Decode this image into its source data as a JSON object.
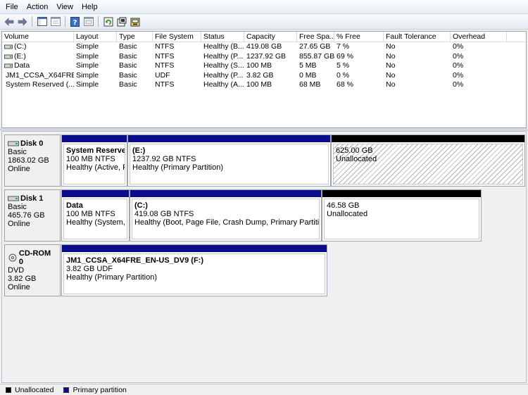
{
  "menu": [
    "File",
    "Action",
    "View",
    "Help"
  ],
  "toolbar": {
    "buttons": [
      "back-arrow-icon",
      "forward-arrow-icon",
      "console-tree-icon",
      "properties-icon",
      "help-icon",
      "export-icon",
      "refresh-icon",
      "settings-icon",
      "disk-icon"
    ]
  },
  "volume_list": {
    "columns": [
      "Volume",
      "Layout",
      "Type",
      "File System",
      "Status",
      "Capacity",
      "Free Spa...",
      "% Free",
      "Fault Tolerance",
      "Overhead"
    ],
    "rows": [
      [
        "(C:)",
        "Simple",
        "Basic",
        "NTFS",
        "Healthy (B...",
        "419.08 GB",
        "27.65 GB",
        "7 %",
        "No",
        "0%"
      ],
      [
        "(E:)",
        "Simple",
        "Basic",
        "NTFS",
        "Healthy (P...",
        "1237.92 GB",
        "855.87 GB",
        "69 %",
        "No",
        "0%"
      ],
      [
        "Data",
        "Simple",
        "Basic",
        "NTFS",
        "Healthy (S...",
        "100 MB",
        "5 MB",
        "5 %",
        "No",
        "0%"
      ],
      [
        "JM1_CCSA_X64FRE...",
        "Simple",
        "Basic",
        "UDF",
        "Healthy (P...",
        "3.82 GB",
        "0 MB",
        "0 %",
        "No",
        "0%"
      ],
      [
        "System Reserved (...",
        "Simple",
        "Basic",
        "NTFS",
        "Healthy (A...",
        "100 MB",
        "68 MB",
        "68 %",
        "No",
        "0%"
      ]
    ]
  },
  "disks": [
    {
      "name": "Disk 0",
      "type": "Basic",
      "size": "1863.02 GB",
      "status": "Online",
      "partitions": [
        {
          "kind": "primary",
          "name": "System Reserved",
          "size": "100 MB NTFS",
          "status": "Healthy (Active, Pri"
        },
        {
          "kind": "primary",
          "name": "(E:)",
          "size": "1237.92 GB NTFS",
          "status": "Healthy (Primary Partition)"
        },
        {
          "kind": "unalloc",
          "name": "",
          "size": "625.00 GB",
          "status": "Unallocated"
        }
      ]
    },
    {
      "name": "Disk 1",
      "type": "Basic",
      "size": "465.76 GB",
      "status": "Online",
      "partitions": [
        {
          "kind": "primary",
          "name": "Data",
          "size": "100 MB NTFS",
          "status": "Healthy (System, Ac"
        },
        {
          "kind": "primary",
          "name": "(C:)",
          "size": "419.08 GB NTFS",
          "status": "Healthy (Boot, Page File, Crash Dump, Primary Partition)"
        },
        {
          "kind": "unalloc",
          "name": "",
          "size": "46.58 GB",
          "status": "Unallocated"
        }
      ]
    },
    {
      "name": "CD-ROM 0",
      "type": "DVD",
      "size": "3.82 GB",
      "status": "Online",
      "partitions": [
        {
          "kind": "primary",
          "name": "JM1_CCSA_X64FRE_EN-US_DV9  (F:)",
          "size": "3.82 GB UDF",
          "status": "Healthy (Primary Partition)"
        }
      ]
    }
  ],
  "legend": {
    "unallocated": "Unallocated",
    "primary": "Primary partition",
    "unallocated_color": "#000000",
    "primary_color": "#0d0d8c"
  }
}
